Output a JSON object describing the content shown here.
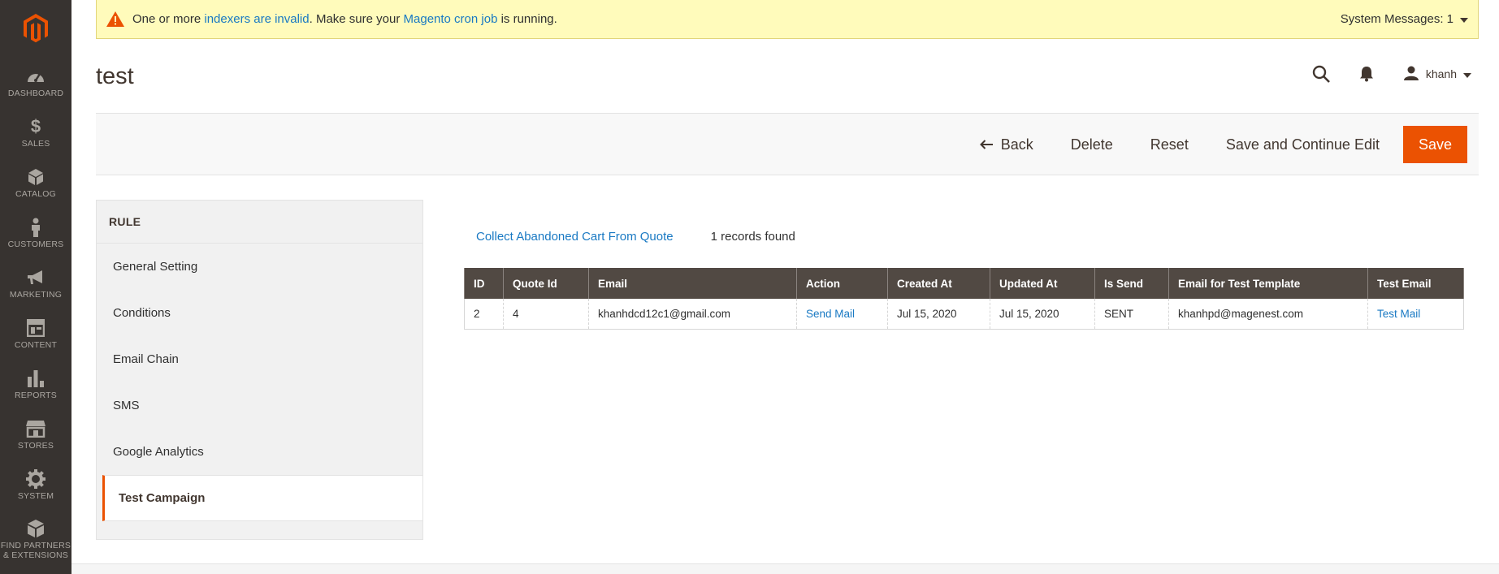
{
  "nav": {
    "items": [
      {
        "label": "Dashboard",
        "icon": "dashboard-icon"
      },
      {
        "label": "Sales",
        "icon": "dollar-icon"
      },
      {
        "label": "Catalog",
        "icon": "cube-icon"
      },
      {
        "label": "Customers",
        "icon": "person-icon"
      },
      {
        "label": "Marketing",
        "icon": "megaphone-icon"
      },
      {
        "label": "Content",
        "icon": "layout-icon"
      },
      {
        "label": "Reports",
        "icon": "bar-chart-icon"
      },
      {
        "label": "Stores",
        "icon": "store-icon"
      },
      {
        "label": "System",
        "icon": "gear-icon"
      },
      {
        "label": "Find Partners & Extensions",
        "icon": "boxes-icon"
      }
    ]
  },
  "system_message": {
    "text_1": "One or more ",
    "link_1": "indexers are invalid",
    "text_2": ". Make sure your ",
    "link_2": "Magento cron job",
    "text_3": " is running.",
    "counter_label": "System Messages: 1"
  },
  "header": {
    "title": "test",
    "user": "khanh"
  },
  "actions": {
    "back": "Back",
    "delete": "Delete",
    "reset": "Reset",
    "save_continue": "Save and Continue Edit",
    "save": "Save"
  },
  "tabs": {
    "title": "RULE",
    "items": [
      "General Setting",
      "Conditions",
      "Email Chain",
      "SMS",
      "Google Analytics",
      "Test Campaign"
    ],
    "active_index": 5
  },
  "grid": {
    "collect_link": "Collect Abandoned Cart From Quote",
    "records_found": "1 records found",
    "columns": [
      "ID",
      "Quote Id",
      "Email",
      "Action",
      "Created At",
      "Updated At",
      "Is Send",
      "Email for Test Template",
      "Test Email"
    ],
    "rows": [
      {
        "id": "2",
        "quote_id": "4",
        "email": "khanhdcd12c1@gmail.com",
        "action": "Send Mail",
        "created_at": "Jul 15, 2020",
        "updated_at": "Jul 15, 2020",
        "is_send": "SENT",
        "test_template_email": "khanhpd@magenest.com",
        "test_email": "Test Mail"
      }
    ]
  },
  "colors": {
    "nav_bg": "#373330",
    "accent": "#eb5202",
    "link": "#1979c3",
    "grid_header": "#514943",
    "message_bg": "#fffbbb"
  }
}
